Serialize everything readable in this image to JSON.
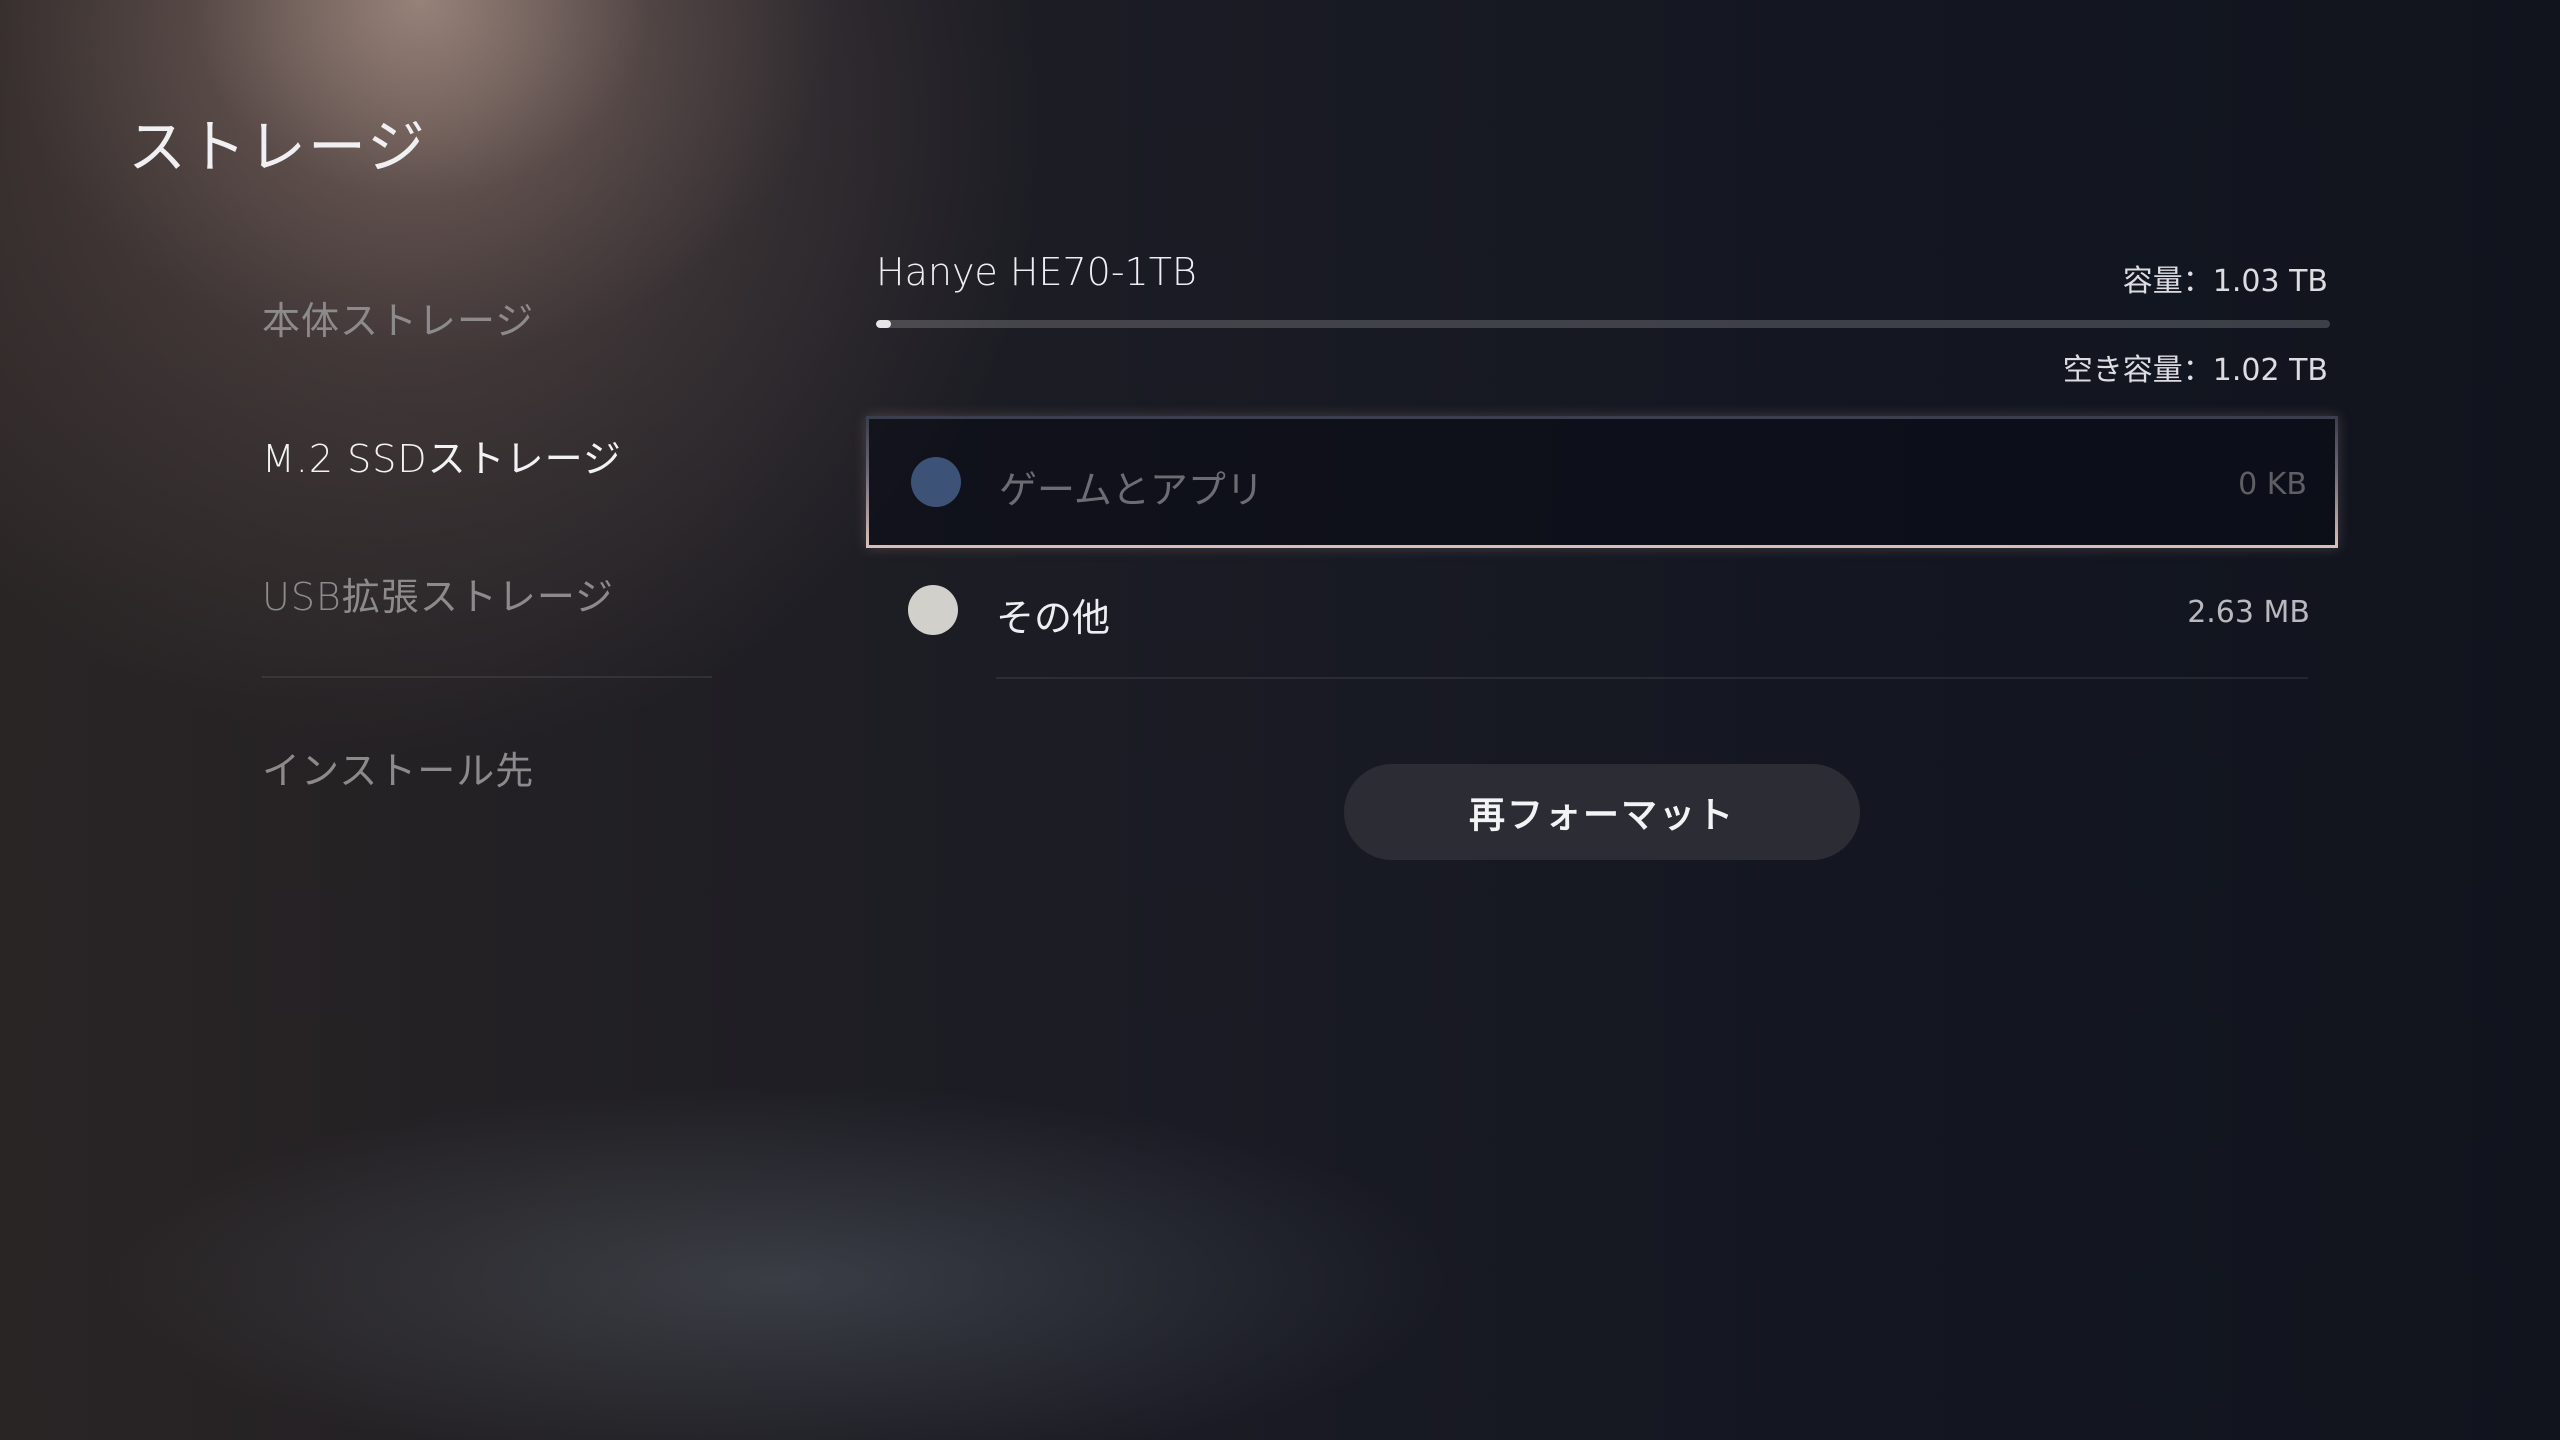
{
  "page": {
    "title": "ストレージ"
  },
  "sidebar": {
    "items": [
      {
        "label": "本体ストレージ",
        "active": false
      },
      {
        "label": "M.2 SSDストレージ",
        "active": true
      },
      {
        "label": "USB拡張ストレージ",
        "active": false
      },
      {
        "label": "インストール先",
        "active": false
      }
    ]
  },
  "drive": {
    "name": "Hanye HE70-1TB",
    "capacity_label": "容量：1.03 TB",
    "free_label": "空き容量：1.02 TB",
    "used_fraction": 0.01
  },
  "categories": [
    {
      "label": "ゲームとアプリ",
      "size": "0 KB",
      "dot_color": "#3d5277",
      "label_color": "#6d6c72",
      "focused": true
    },
    {
      "label": "その他",
      "size": "2.63 MB",
      "dot_color": "#d2d0cb",
      "label_color": "#eeeef2",
      "focused": false
    }
  ],
  "actions": {
    "reformat_label": "再フォーマット"
  },
  "colors": {
    "accent_focus": "#d8bfb6",
    "button_bg": "#2c2d34"
  }
}
